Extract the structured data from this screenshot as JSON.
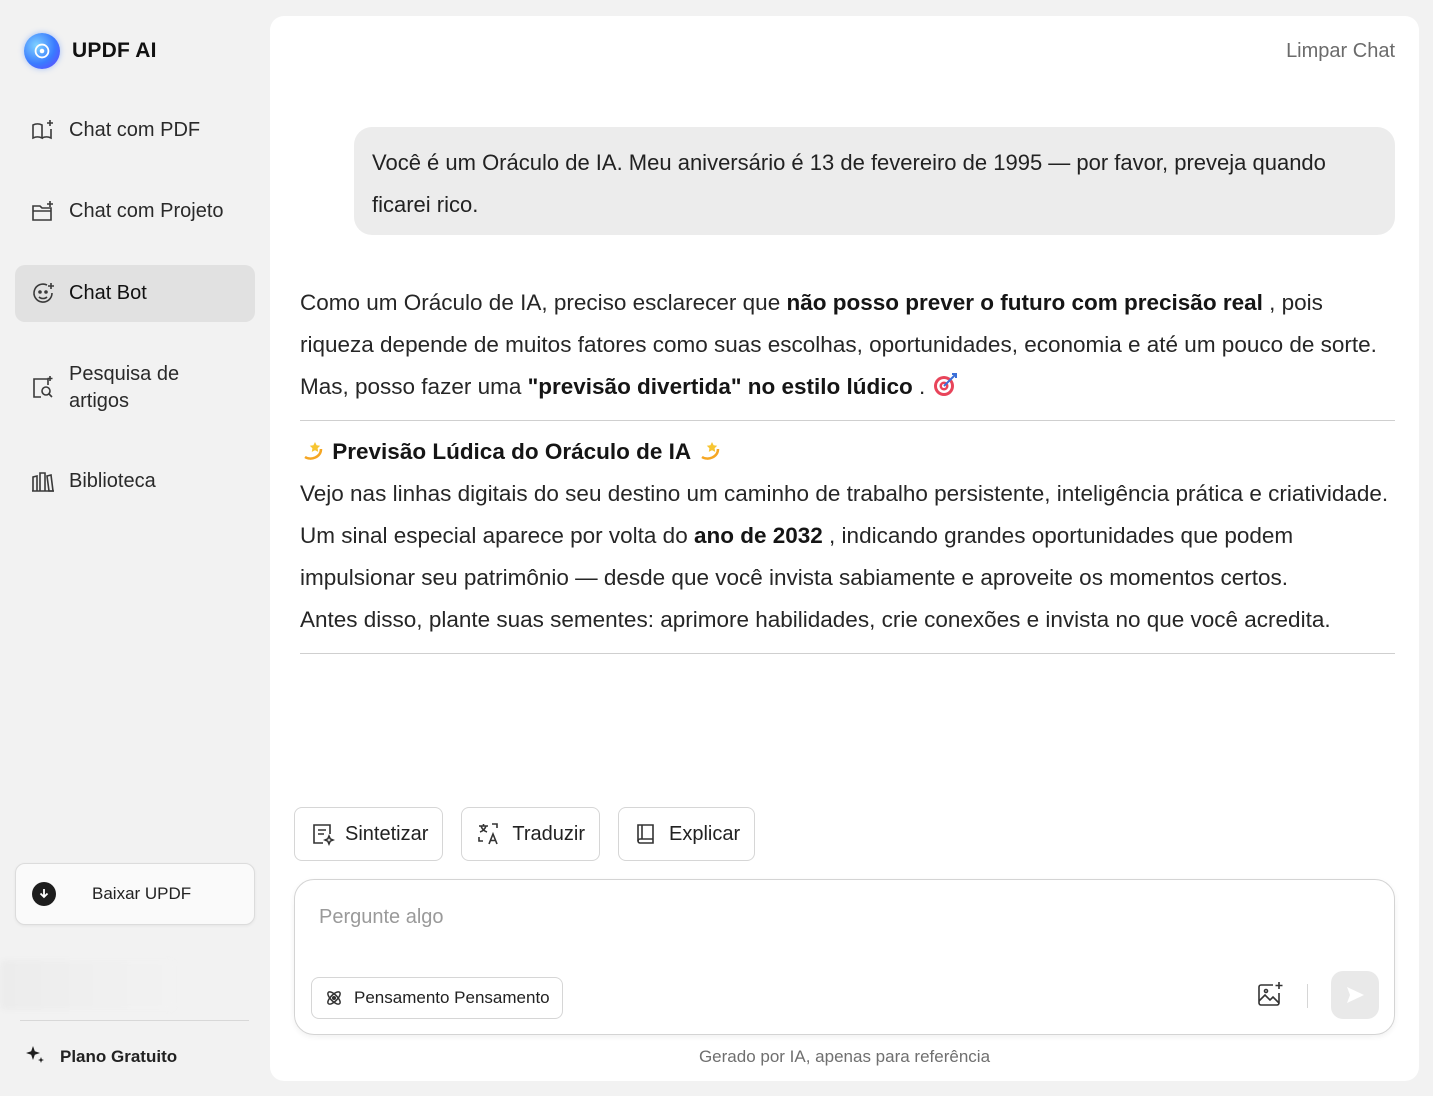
{
  "brand": {
    "name": "UPDF AI"
  },
  "sidebar": {
    "items": [
      {
        "label": "Chat com PDF",
        "icon": "book-sparkle-icon"
      },
      {
        "label": "Chat com Projeto",
        "icon": "folder-sparkle-icon"
      },
      {
        "label": "Chat Bot",
        "icon": "bot-face-icon",
        "active": true
      },
      {
        "label": "Pesquisa de artigos",
        "icon": "article-search-icon"
      },
      {
        "label": "Biblioteca",
        "icon": "library-icon"
      }
    ],
    "download_label": "Baixar UPDF",
    "plan_label": "Plano Gratuito"
  },
  "header": {
    "clear_chat": "Limpar Chat"
  },
  "conversation": {
    "user_message": "Você é um Oráculo de IA. Meu aniversário é 13 de fevereiro de 1995 — por favor, preveja quando ficarei rico.",
    "answer": {
      "p1_a": "Como um Oráculo de IA, preciso esclarecer que ",
      "p1_b": "não posso prever o futuro com precisão real",
      "p1_c": " , pois riqueza depende de muitos fatores como suas escolhas, oportunidades, economia e até um pouco de sorte.",
      "p2_a": "Mas, posso fazer uma ",
      "p2_b": "\"previsão divertida\" no estilo lúdico",
      "p2_c": " . ",
      "heading": "Previsão Lúdica do Oráculo de IA",
      "p3": "Vejo nas linhas digitais do seu destino um caminho de trabalho persistente, inteligência prática e criatividade.",
      "p4_a": "Um sinal especial aparece por volta do ",
      "p4_b": "ano de 2032",
      "p4_c": " , indicando grandes oportunidades que podem impulsionar seu patrimônio — desde que você invista sabiamente e aproveite os momentos certos.",
      "p5": "Antes disso, plante suas sementes: aprimore habilidades, crie conexões e invista no que você acredita."
    }
  },
  "actions": [
    {
      "label": "Sintetizar",
      "icon": "summarize-icon"
    },
    {
      "label": "Traduzir",
      "icon": "translate-icon"
    },
    {
      "label": "Explicar",
      "icon": "book-icon"
    }
  ],
  "input": {
    "placeholder": "Pergunte algo",
    "value": "",
    "thinking_label": "Pensamento Pensamento"
  },
  "footer": {
    "note": "Gerado por IA, apenas para referência"
  },
  "colors": {
    "accent": "#3a7bff",
    "active_nav": "#e1e1e1",
    "bubble": "#ececec"
  }
}
